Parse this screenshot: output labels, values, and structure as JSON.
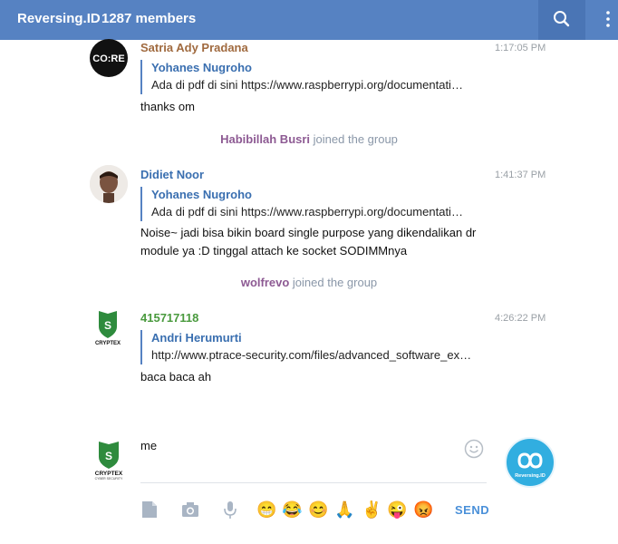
{
  "header": {
    "title": "Reversing.ID",
    "members": "1287 members",
    "search_icon": "search-icon",
    "menu_icon": "more-vertical-icon",
    "bg": "#5682c2"
  },
  "messages": [
    {
      "sender": "Satria Ady Pradana",
      "sender_color": "#a06a3f",
      "time": "1:17:05 PM",
      "avatar_text": "CO:RE",
      "reply_name": "Yohanes Nugroho",
      "reply_text": "Ada di pdf di sini https://www.raspberrypi.org/documentati…",
      "text": "thanks om"
    },
    {
      "sender": "Didiet Noor",
      "sender_color": "#3a6fb0",
      "time": "1:41:37 PM",
      "reply_name": "Yohanes Nugroho",
      "reply_text": "Ada di pdf di sini https://www.raspberrypi.org/documentati…",
      "text_line1": "Noise~ jadi bisa bikin board single purpose yang dikendalikan dr",
      "text_line2": "module ya :D tinggal attach ke socket SODIMMnya"
    },
    {
      "sender": "415717118",
      "sender_color": "#4a9a3e",
      "time": "4:26:22 PM",
      "avatar_text": "CRYPTEX",
      "reply_name": "Andri Herumurti",
      "reply_text": "http://www.ptrace-security.com/files/advanced_software_ex…",
      "text": "baca baca ah"
    }
  ],
  "service": [
    {
      "name": "Habibillah Busri",
      "action": "joined the group"
    },
    {
      "name": "wolfrevo",
      "action": "joined the group"
    }
  ],
  "composer": {
    "input_value": "me",
    "avatar_text": "CRYPTEX",
    "avatar_subtext": "CYBER SECURITY",
    "logo_text": "Reversing.ID",
    "send_label": "SEND",
    "emojis": [
      "😁",
      "😂",
      "😊",
      "🙏",
      "✌",
      "😜",
      "😡"
    ]
  }
}
